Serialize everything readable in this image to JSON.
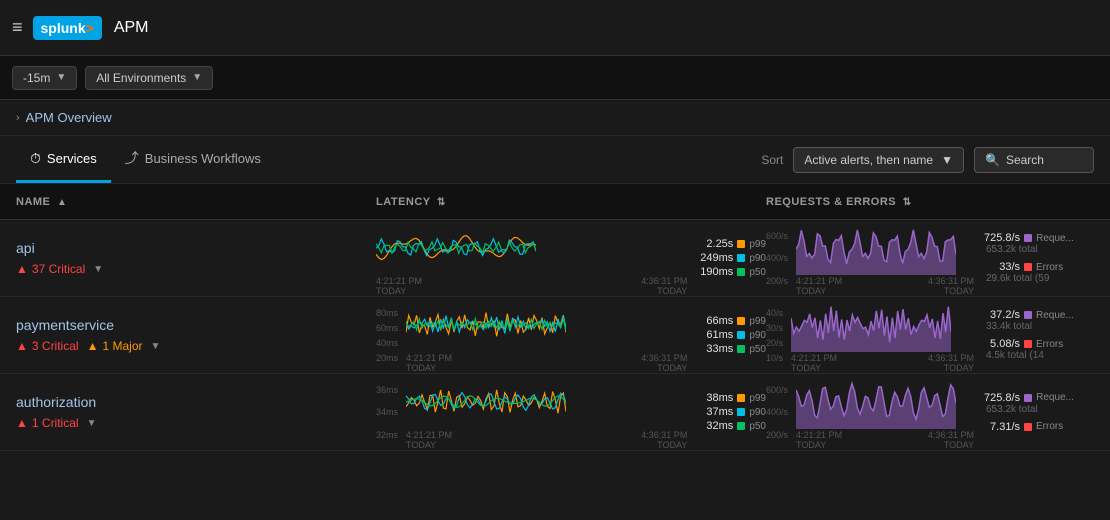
{
  "header": {
    "logo": "splunk>",
    "logo_accent": ">",
    "app_title": "APM",
    "hamburger_icon": "≡"
  },
  "toolbar": {
    "time": "-15m",
    "time_caret": "▼",
    "environment": "All Environments",
    "env_caret": "▼"
  },
  "breadcrumb": {
    "chevron": "›",
    "link": "APM Overview"
  },
  "tabs": [
    {
      "id": "services",
      "label": "Services",
      "icon": "⏱",
      "active": true
    },
    {
      "id": "workflows",
      "label": "Business Workflows",
      "icon": "⤴",
      "active": false
    }
  ],
  "sort": {
    "label": "Sort",
    "value": "Active alerts, then name",
    "caret": "▼"
  },
  "search": {
    "placeholder": "Search",
    "icon": "🔍"
  },
  "table": {
    "columns": [
      {
        "id": "name",
        "label": "NAME",
        "sort": "▲"
      },
      {
        "id": "latency",
        "label": "LATENCY",
        "sort": "⇅"
      },
      {
        "id": "requests",
        "label": "REQUESTS & ERRORS",
        "sort": "⇅"
      }
    ]
  },
  "services": [
    {
      "name": "api",
      "alerts": [
        {
          "type": "critical",
          "count": 37,
          "label": "Critical"
        }
      ],
      "latency": {
        "p99_value": "2.25s",
        "p90_value": "249ms",
        "p50_value": "190ms",
        "time_start": "4:21:21 PM",
        "time_end": "4:36:31 PM",
        "time_label": "TODAY"
      },
      "requests": {
        "req_value": "725.8/s",
        "req_total": "653.2k total",
        "err_value": "33/s",
        "err_total": "29.6k total (59",
        "time_start": "4:21:21 PM",
        "time_end": "4:36:31 PM",
        "time_label": "TODAY",
        "y_labels": [
          "600/s",
          "400/s",
          "200/s"
        ]
      }
    },
    {
      "name": "paymentservice",
      "alerts": [
        {
          "type": "critical",
          "count": 3,
          "label": "Critical"
        },
        {
          "type": "major",
          "count": 1,
          "label": "Major"
        }
      ],
      "latency": {
        "p99_value": "66ms",
        "p90_value": "61ms",
        "p50_value": "33ms",
        "time_start": "4:21:21 PM",
        "time_end": "4:36:31 PM",
        "time_label": "TODAY",
        "y_labels": [
          "80ms",
          "60ms",
          "40ms",
          "20ms"
        ]
      },
      "requests": {
        "req_value": "37.2/s",
        "req_total": "33.4k total",
        "err_value": "5.08/s",
        "err_total": "4.5k total (14",
        "time_start": "4:21:21 PM",
        "time_end": "4:36:31 PM",
        "time_label": "TODAY",
        "y_labels": [
          "40/s",
          "30/s",
          "20/s",
          "10/s"
        ]
      }
    },
    {
      "name": "authorization",
      "alerts": [
        {
          "type": "critical",
          "count": 1,
          "label": "Critical"
        }
      ],
      "latency": {
        "p99_value": "38ms",
        "p90_value": "37ms",
        "p50_value": "32ms",
        "time_start": "4:21:21 PM",
        "time_end": "4:36:31 PM",
        "time_label": "TODAY",
        "y_labels": [
          "36ms",
          "34ms",
          "32ms"
        ]
      },
      "requests": {
        "req_value": "725.8/s",
        "req_total": "653.2k total",
        "err_value": "7.31/s",
        "err_total": "",
        "time_start": "4:21:21 PM",
        "time_end": "4:36:31 PM",
        "time_label": "TODAY",
        "y_labels": [
          "600/s",
          "400/s",
          "200/s"
        ]
      }
    }
  ],
  "colors": {
    "p99": "#ff9900",
    "p90": "#00c0e0",
    "p50": "#00c060",
    "requests": "#9966cc",
    "errors": "#ff4444",
    "critical": "#ff4444",
    "major": "#ff9900",
    "accent": "#00a4e4"
  }
}
